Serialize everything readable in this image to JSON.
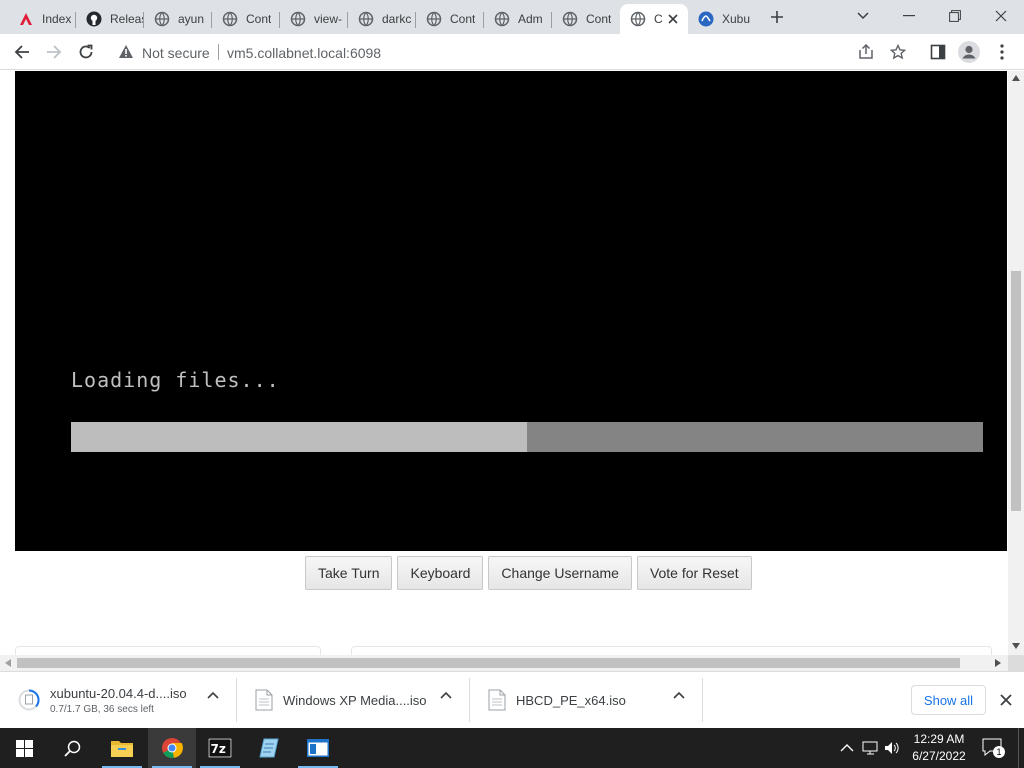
{
  "browser": {
    "tabs": [
      {
        "title": "Index",
        "favicon": "aruba-a-icon",
        "active": false
      },
      {
        "title": "Releases",
        "favicon": "github-icon",
        "active": false
      },
      {
        "title": "ayun",
        "favicon": "globe-icon",
        "active": false
      },
      {
        "title": "Cont",
        "favicon": "globe-icon",
        "active": false
      },
      {
        "title": "view-",
        "favicon": "globe-icon",
        "active": false
      },
      {
        "title": "darkc",
        "favicon": "globe-icon",
        "active": false
      },
      {
        "title": "Cont",
        "favicon": "globe-icon",
        "active": false
      },
      {
        "title": "Adm",
        "favicon": "globe-icon",
        "active": false
      },
      {
        "title": "Cont",
        "favicon": "globe-icon",
        "active": false
      },
      {
        "title": "C",
        "favicon": "globe-icon",
        "active": true
      },
      {
        "title": "Xubu",
        "favicon": "xubuntu-icon",
        "active": false
      }
    ],
    "security_label": "Not secure",
    "url": "vm5.collabnet.local:6098"
  },
  "vm": {
    "loading_text": "Loading files...",
    "progress_fraction": 0.5,
    "buttons": [
      "Take Turn",
      "Keyboard",
      "Change Username",
      "Vote for Reset"
    ]
  },
  "downloads": {
    "items": [
      {
        "name": "xubuntu-20.04.4-d....iso",
        "status": "0.7/1.7 GB, 36 secs left"
      },
      {
        "name": "Windows XP Media....iso",
        "status": ""
      },
      {
        "name": "HBCD_PE_x64.iso",
        "status": ""
      }
    ],
    "show_all_label": "Show all"
  },
  "taskbar": {
    "time": "12:29 AM",
    "date": "6/27/2022",
    "notification_count": "1",
    "apps": [
      "file-explorer-icon",
      "chrome-icon",
      "7zip-icon",
      "notepad-icon",
      "window-app-icon"
    ]
  },
  "colors": {
    "vm_background": "#000000",
    "progress_track": "#848484",
    "progress_fill": "#bdbdbd",
    "accent": "#1a73e8"
  }
}
